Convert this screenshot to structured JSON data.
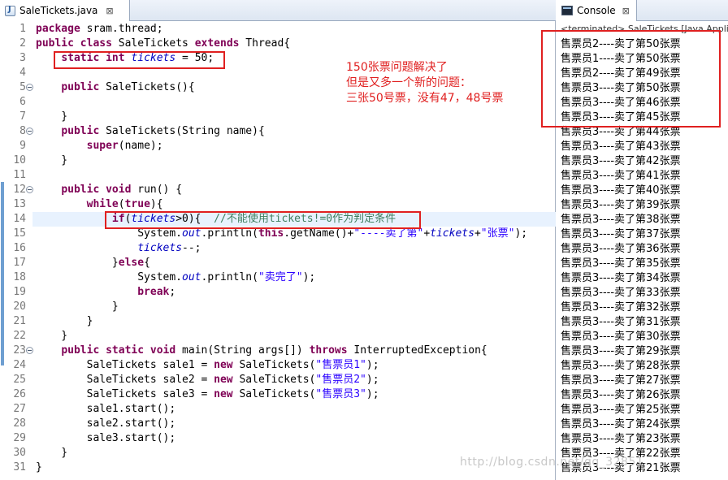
{
  "editor": {
    "tab_title": "SaleTickets.java",
    "tab_close": "⊠"
  },
  "code": {
    "line_numbers": [
      "1",
      "2",
      "3",
      "4",
      "5",
      "6",
      "7",
      "8",
      "9",
      "10",
      "11",
      "12",
      "13",
      "14",
      "15",
      "16",
      "17",
      "18",
      "19",
      "20",
      "21",
      "22",
      "23",
      "24",
      "25",
      "26",
      "27",
      "28",
      "29",
      "30",
      "31"
    ],
    "lines": [
      "package sram.thread;",
      "public class SaleTickets extends Thread{",
      "    static int tickets = 50;",
      "",
      "    public SaleTickets(){",
      "",
      "    }",
      "    public SaleTickets(String name){",
      "        super(name);",
      "    }",
      "",
      "    public void run() {",
      "        while(true){",
      "            if(tickets>0){  //不能使用tickets!=0作为判定条件",
      "                System.out.println(this.getName()+\"----卖了第\"+tickets+\"张票\");",
      "                tickets--;",
      "            }else{",
      "                System.out.println(\"卖完了\");",
      "                break;",
      "            }",
      "        }",
      "    }",
      "    public static void main(String args[]) throws InterruptedException{",
      "        SaleTickets sale1 = new SaleTickets(\"售票员1\");",
      "        SaleTickets sale2 = new SaleTickets(\"售票员2\");",
      "        SaleTickets sale3 = new SaleTickets(\"售票员3\");",
      "        sale1.start();",
      "        sale2.start();",
      "        sale3.start();",
      "    }",
      "}"
    ],
    "current_line": 14
  },
  "annotation": {
    "lines": [
      "150张票问题解决了",
      "但是又多一个新的问题：",
      "三张50号票，没有47，48号票"
    ],
    "color": "#e02020"
  },
  "console": {
    "tab_title": "Console",
    "tab_close": "⊠",
    "status": "<terminated> SaleTickets [Java Application]",
    "output": [
      "售票员2----卖了第50张票",
      "售票员1----卖了第50张票",
      "售票员2----卖了第49张票",
      "售票员3----卖了第50张票",
      "售票员3----卖了第46张票",
      "售票员3----卖了第45张票",
      "售票员3----卖了第44张票",
      "售票员3----卖了第43张票",
      "售票员3----卖了第42张票",
      "售票员3----卖了第41张票",
      "售票员3----卖了第40张票",
      "售票员3----卖了第39张票",
      "售票员3----卖了第38张票",
      "售票员3----卖了第37张票",
      "售票员3----卖了第36张票",
      "售票员3----卖了第35张票",
      "售票员3----卖了第34张票",
      "售票员3----卖了第33张票",
      "售票员3----卖了第32张票",
      "售票员3----卖了第31张票",
      "售票员3----卖了第30张票",
      "售票员3----卖了第29张票",
      "售票员3----卖了第28张票",
      "售票员3----卖了第27张票",
      "售票员3----卖了第26张票",
      "售票员3----卖了第25张票",
      "售票员3----卖了第24张票",
      "售票员3----卖了第23张票",
      "售票员3----卖了第22张票",
      "售票员3----卖了第21张票"
    ]
  },
  "watermark": "http://blog.csdn.net/qq_32851"
}
